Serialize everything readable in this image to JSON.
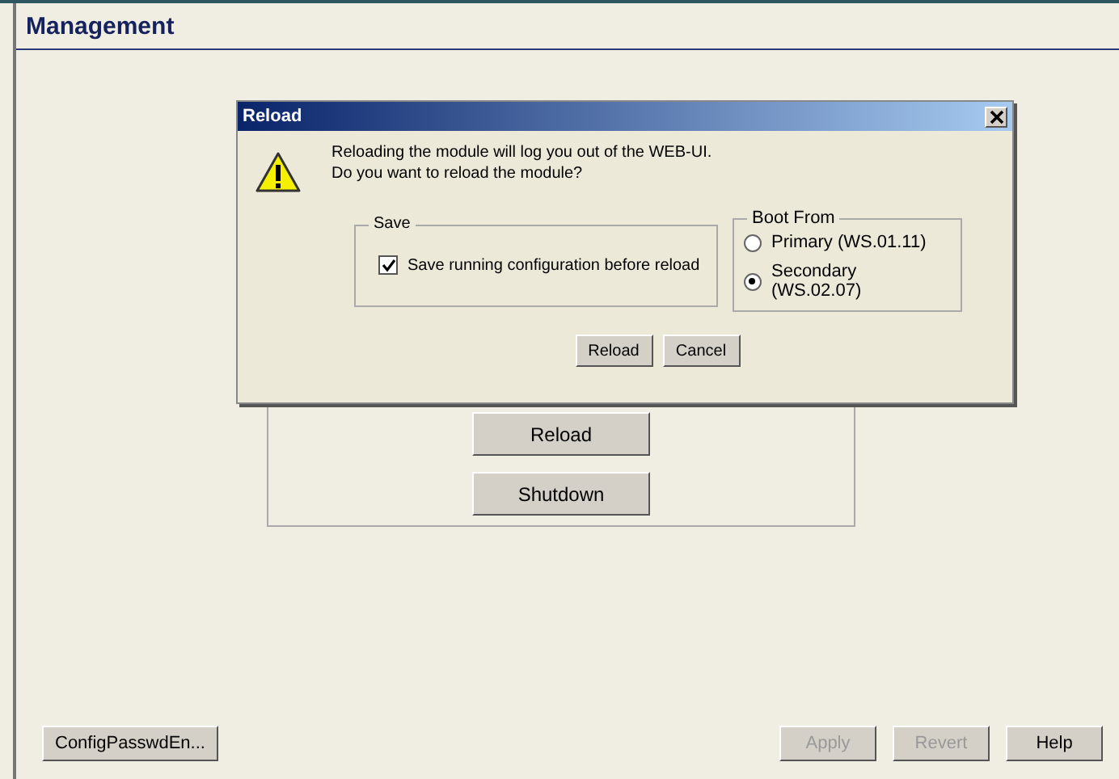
{
  "header": {
    "title": "Management"
  },
  "panel": {
    "buttons": [
      "Reload",
      "Shutdown"
    ]
  },
  "footer": {
    "left_buttons": [
      {
        "label": "ConfigPasswdEn...",
        "disabled": false
      }
    ],
    "right_buttons": [
      {
        "label": "Apply",
        "disabled": true
      },
      {
        "label": "Revert",
        "disabled": true
      },
      {
        "label": "Help",
        "disabled": false
      }
    ]
  },
  "dialog": {
    "title": "Reload",
    "message": [
      "Reloading the module will log you out of the WEB-UI.",
      "Do you want to reload the module?"
    ],
    "save": {
      "legend": "Save",
      "checkbox": {
        "label": "Save running configuration before reload",
        "checked": true
      }
    },
    "boot_from": {
      "legend": "Boot From",
      "options": [
        {
          "label": "Primary (WS.01.11)",
          "selected": false
        },
        {
          "label": "Secondary (WS.02.07)",
          "selected": true
        }
      ]
    },
    "buttons": [
      "Reload",
      "Cancel"
    ]
  }
}
